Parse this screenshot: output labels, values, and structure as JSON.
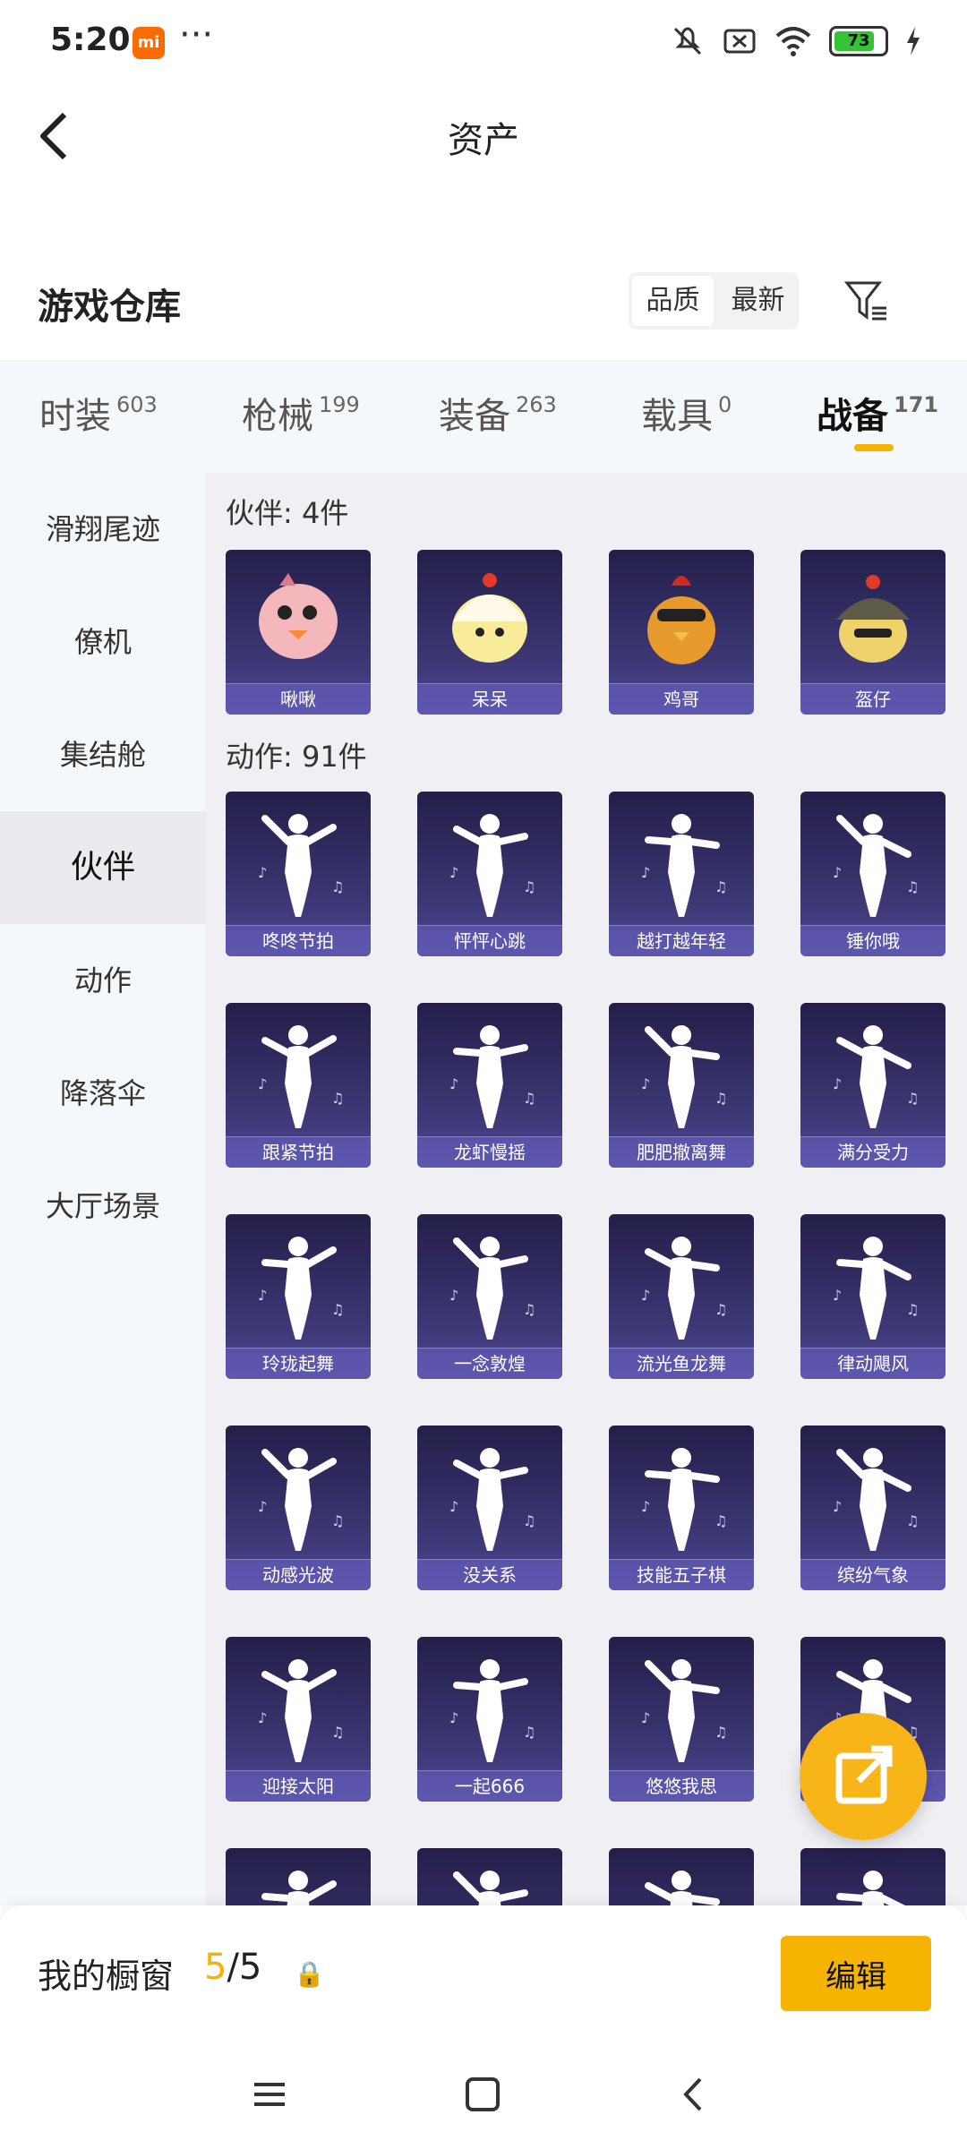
{
  "status": {
    "time": "5:20",
    "battery": "73"
  },
  "header": {
    "title": "资产"
  },
  "section": {
    "title": "游戏仓库",
    "sort_quality": "品质",
    "sort_newest": "最新"
  },
  "tabs": [
    {
      "label": "时装",
      "count": "603"
    },
    {
      "label": "枪械",
      "count": "199"
    },
    {
      "label": "装备",
      "count": "263"
    },
    {
      "label": "载具",
      "count": "0"
    },
    {
      "label": "战备",
      "count": "171"
    }
  ],
  "sidenav": [
    "滑翔尾迹",
    "僚机",
    "集结舱",
    "伙伴",
    "动作",
    "降落伞",
    "大厅场景"
  ],
  "groups": {
    "partners": {
      "title": "伙伴: 4件",
      "items": [
        "啾啾",
        "呆呆",
        "鸡哥",
        "盔仔"
      ]
    },
    "actions": {
      "title": "动作: 91件",
      "items": [
        "咚咚节拍",
        "怦怦心跳",
        "越打越年轻",
        "锤你哦",
        "跟紧节拍",
        "龙虾慢摇",
        "肥肥撤离舞",
        "满分受力",
        "玲珑起舞",
        "一念敦煌",
        "流光鱼龙舞",
        "律动飓风",
        "动感光波",
        "没关系",
        "技能五子棋",
        "缤纷气象",
        "迎接太阳",
        "一起666",
        "悠悠我思",
        ""
      ]
    }
  },
  "bottom": {
    "label": "我的橱窗",
    "current": "5",
    "total": "/5",
    "edit": "编辑"
  },
  "colors": {
    "accent": "#f6b400",
    "card": "#2e2a5e"
  }
}
